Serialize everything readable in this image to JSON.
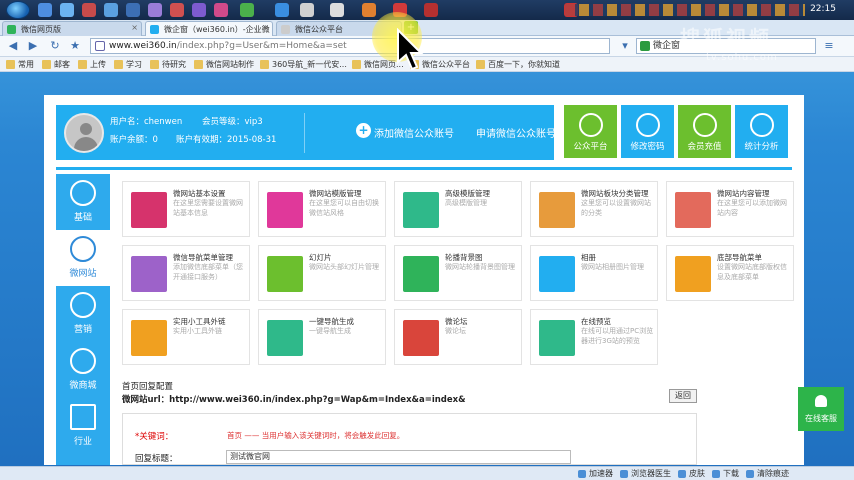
{
  "tabs": [
    {
      "label": "微信网页版",
      "active": false
    },
    {
      "label": "微企窗（wei360.in）-企业微",
      "active": true
    },
    {
      "label": "微信公众平台",
      "active": false
    }
  ],
  "clock": "22:15",
  "address": {
    "host": "www.wei360.in",
    "path": "/index.php?g=User&m=Home&a=set"
  },
  "search": {
    "value": "微企窗"
  },
  "watermark": {
    "line1": "搜狐视频",
    "line2": "tv.sohu.com"
  },
  "bookmarks": [
    "常用",
    "邮客",
    "上传",
    "学习",
    "待研究",
    "微信网站制作",
    "360导航_新一代安...",
    "微信网页...",
    "微信公众平台",
    "百度一下，你就知道"
  ],
  "user": {
    "name_label": "用户名：chenwen",
    "level_label": "会员等级：vip3",
    "balance_label": "账户余额：0",
    "expiry_label": "账户有效期：2015-08-31"
  },
  "actions": {
    "add": "添加微信公众账号",
    "apply": "申请微信公众账号"
  },
  "tiles": [
    {
      "label": "公众平台",
      "color": "#6cbf2e"
    },
    {
      "label": "修改密码",
      "color": "#22aef0"
    },
    {
      "label": "会员充值",
      "color": "#6cbf2e"
    },
    {
      "label": "统计分析",
      "color": "#22aef0"
    }
  ],
  "sidebar": [
    {
      "label": "基础",
      "active": false
    },
    {
      "label": "微网站",
      "active": true
    },
    {
      "label": "营销",
      "active": false
    },
    {
      "label": "微商城",
      "active": false
    },
    {
      "label": "行业",
      "active": false
    }
  ],
  "cards": [
    {
      "title": "微网站基本设置",
      "desc": "在这里您需要设置微网站基本信息",
      "color": "#d6336c"
    },
    {
      "title": "微网站模版管理",
      "desc": "在这里您可以自由切换微信站风格",
      "color": "#e0389a"
    },
    {
      "title": "高级模版管理",
      "desc": "高级模版管理",
      "color": "#2fb98a"
    },
    {
      "title": "微网站板块分类管理",
      "desc": "这里您可以设置微网站的分类",
      "color": "#e79b3c"
    },
    {
      "title": "微网站内容管理",
      "desc": "在这里您可以添加微网站内容",
      "color": "#e36a5c"
    },
    {
      "title": "微信导航菜单管理",
      "desc": "添加微信底部菜单（您开通接口服务）",
      "color": "#9d62c9"
    },
    {
      "title": "幻灯片",
      "desc": "微网站头部幻灯片管理",
      "color": "#6cbf2e"
    },
    {
      "title": "轮播背景图",
      "desc": "微网站轮播背景图管理",
      "color": "#2fb35a"
    },
    {
      "title": "相册",
      "desc": "微网站相册图片管理",
      "color": "#22aef0"
    },
    {
      "title": "底部导航菜单",
      "desc": "设置微网站底部版权信息及底部菜单",
      "color": "#f0a020"
    },
    {
      "title": "实用小工具外链",
      "desc": "实用小工具外链",
      "color": "#f0a020"
    },
    {
      "title": "一键导航生成",
      "desc": "一键导航生成",
      "color": "#2fb98a"
    },
    {
      "title": "微论坛",
      "desc": "微论坛",
      "color": "#d9453b"
    },
    {
      "title": "在线预览",
      "desc": "在线可以用通过PC浏览器进行3G站的预览",
      "color": "#2fb98a"
    }
  ],
  "section": {
    "title": "首页回复配置",
    "url": "微网站url：http://www.wei360.in/index.php?g=Wap&m=Index&a=index&",
    "back": "返回"
  },
  "form": {
    "keyword_label": "*关键词：",
    "keyword_hint": "首页 —— 当用户输入该关键词时，将会触发此回复。",
    "reply_title_label": "回复标题：",
    "reply_title_value": "测试微官网"
  },
  "service": {
    "label": "在线客服"
  },
  "statusbar": [
    "加速器",
    "浏览器医生",
    "皮肤",
    "下载",
    "清除痕迹"
  ]
}
